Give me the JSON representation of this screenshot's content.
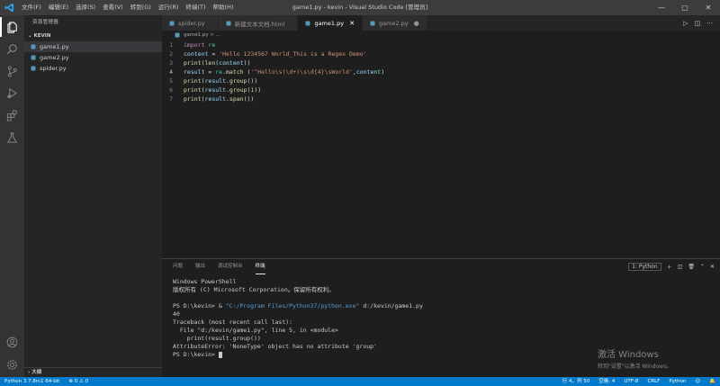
{
  "window": {
    "title": "game1.py - kevin - Visual Studio Code [管理员]",
    "menu": [
      "文件(F)",
      "编辑(E)",
      "选择(S)",
      "查看(V)",
      "转到(G)",
      "运行(R)",
      "终端(T)",
      "帮助(H)"
    ],
    "controls": {
      "minimize": "—",
      "maximize": "▢",
      "close": "✕"
    }
  },
  "sidebar": {
    "title": "资源管理器",
    "section": "KEVIN",
    "files": [
      {
        "name": "game1.py",
        "selected": true
      },
      {
        "name": "game2.py",
        "selected": false
      },
      {
        "name": "spider.py",
        "selected": false
      }
    ],
    "outline": "大纲"
  },
  "tabs": [
    {
      "name": "spider.py",
      "active": false,
      "modified": false
    },
    {
      "name": "新建文本文档.html",
      "active": false,
      "modified": false
    },
    {
      "name": "game1.py",
      "active": true,
      "modified": false
    },
    {
      "name": "game2.py",
      "active": false,
      "modified": true
    }
  ],
  "breadcrumb": "game1.py > ...",
  "editor": {
    "current_line": 4,
    "lines": [
      [
        {
          "t": "import ",
          "c": "#c586c0"
        },
        {
          "t": "re",
          "c": "#4ec9b0"
        }
      ],
      [
        {
          "t": "content",
          "c": "#9cdcfe"
        },
        {
          "t": " = ",
          "c": "#d4d4d4"
        },
        {
          "t": "'Hello 1234567 World_This is a Regex Demo'",
          "c": "#ce9178"
        }
      ],
      [
        {
          "t": "print",
          "c": "#dcdcaa"
        },
        {
          "t": "(",
          "c": "#d4d4d4"
        },
        {
          "t": "len",
          "c": "#dcdcaa"
        },
        {
          "t": "(",
          "c": "#d4d4d4"
        },
        {
          "t": "content",
          "c": "#9cdcfe"
        },
        {
          "t": "))",
          "c": "#d4d4d4"
        }
      ],
      [
        {
          "t": "result",
          "c": "#9cdcfe"
        },
        {
          "t": " = ",
          "c": "#d4d4d4"
        },
        {
          "t": "re",
          "c": "#4ec9b0"
        },
        {
          "t": ".",
          "c": "#d4d4d4"
        },
        {
          "t": "match",
          "c": "#dcdcaa"
        },
        {
          "t": " (",
          "c": "#d4d4d4"
        },
        {
          "t": "'^Hello\\s(\\d+)\\s\\d{4}\\sWorld'",
          "c": "#ce9178"
        },
        {
          "t": ",",
          "c": "#d4d4d4"
        },
        {
          "t": "content",
          "c": "#9cdcfe"
        },
        {
          "t": ")",
          "c": "#d4d4d4"
        }
      ],
      [
        {
          "t": "print",
          "c": "#dcdcaa"
        },
        {
          "t": "(",
          "c": "#d4d4d4"
        },
        {
          "t": "result",
          "c": "#9cdcfe"
        },
        {
          "t": ".",
          "c": "#d4d4d4"
        },
        {
          "t": "group",
          "c": "#dcdcaa"
        },
        {
          "t": "())",
          "c": "#d4d4d4"
        }
      ],
      [
        {
          "t": "print",
          "c": "#dcdcaa"
        },
        {
          "t": "(",
          "c": "#d4d4d4"
        },
        {
          "t": "result",
          "c": "#9cdcfe"
        },
        {
          "t": ".",
          "c": "#d4d4d4"
        },
        {
          "t": "group",
          "c": "#dcdcaa"
        },
        {
          "t": "(",
          "c": "#d4d4d4"
        },
        {
          "t": "1",
          "c": "#b5cea8"
        },
        {
          "t": "))",
          "c": "#d4d4d4"
        }
      ],
      [
        {
          "t": "print",
          "c": "#dcdcaa"
        },
        {
          "t": "(",
          "c": "#d4d4d4"
        },
        {
          "t": "result",
          "c": "#9cdcfe"
        },
        {
          "t": ".",
          "c": "#d4d4d4"
        },
        {
          "t": "span",
          "c": "#dcdcaa"
        },
        {
          "t": "())",
          "c": "#d4d4d4"
        }
      ]
    ]
  },
  "panel": {
    "tabs": [
      {
        "name": "问题",
        "active": false
      },
      {
        "name": "输出",
        "active": false
      },
      {
        "name": "调试控制台",
        "active": false
      },
      {
        "name": "终端",
        "active": true
      }
    ],
    "terminal_selector": "1: Python",
    "terminal_lines": [
      [
        {
          "t": "Windows PowerShell",
          "c": "#cccccc"
        }
      ],
      [
        {
          "t": "版权所有 (C) Microsoft Corporation。保留所有权利。",
          "c": "#cccccc"
        }
      ],
      [
        {
          "t": "",
          "c": "#cccccc"
        }
      ],
      [
        {
          "t": "PS D:\\kevin> & ",
          "c": "#cccccc"
        },
        {
          "t": "\"C:/Program Files/Python37/python.exe\"",
          "c": "#569cd6"
        },
        {
          "t": " d:/kevin/game1.py",
          "c": "#cccccc"
        }
      ],
      [
        {
          "t": "40",
          "c": "#cccccc"
        }
      ],
      [
        {
          "t": "Traceback (most recent call last):",
          "c": "#cccccc"
        }
      ],
      [
        {
          "t": "  File \"d:/kevin/game1.py\", line 5, in <module>",
          "c": "#cccccc"
        }
      ],
      [
        {
          "t": "    print(result.group())",
          "c": "#cccccc"
        }
      ],
      [
        {
          "t": "AttributeError: 'NoneType' object has no attribute 'group'",
          "c": "#cccccc"
        }
      ],
      [
        {
          "t": "PS D:\\kevin> ",
          "c": "#cccccc"
        }
      ]
    ]
  },
  "watermark": {
    "line1": "激活 Windows",
    "line2": "转到\"设置\"以激活 Windows。"
  },
  "statusbar": {
    "interpreter": "Python 3.7.8rc1 64-bit",
    "problems": "⊗ 0  ⚠ 0",
    "position": "行 4，列 50",
    "spaces": "空格: 4",
    "encoding": "UTF-8",
    "eol": "CRLF",
    "language": "Python"
  },
  "colors": {
    "accent": "#007acc",
    "python_icon": "#519aba"
  }
}
